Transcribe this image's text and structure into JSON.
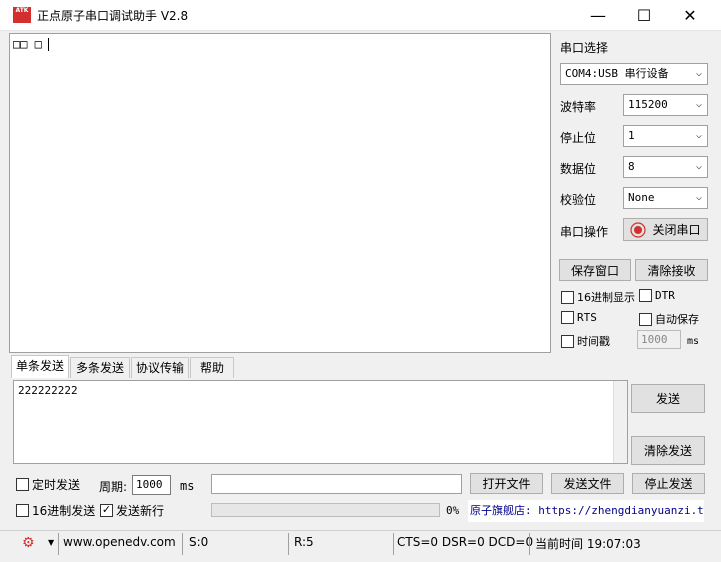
{
  "window": {
    "title": "正点原子串口调试助手 V2.8",
    "icon_text": "ATK",
    "controls": {
      "minimize": "—",
      "maximize": "☐",
      "close": "✕"
    }
  },
  "receive": {
    "content": "□□ □"
  },
  "port_panel": {
    "section_label": "串口选择",
    "port_value": "COM4:USB 串行设备",
    "baud_label": "波特率",
    "baud_value": "115200",
    "stop_label": "停止位",
    "stop_value": "1",
    "data_label": "数据位",
    "data_value": "8",
    "parity_label": "校验位",
    "parity_value": "None",
    "op_label": "串口操作",
    "op_button": "关闭串口",
    "save_window": "保存窗口",
    "clear_receive": "清除接收",
    "hex_display": "16进制显示",
    "dtr": "DTR",
    "rts": "RTS",
    "auto_save": "自动保存",
    "timestamp": "时间戳",
    "timestamp_ms_value": "1000",
    "ms_unit": "ms"
  },
  "tabs": [
    "单条发送",
    "多条发送",
    "协议传输",
    "帮助"
  ],
  "send": {
    "content": "222222222",
    "send_button": "发送",
    "clear_send": "清除发送"
  },
  "bottom": {
    "timed_send": "定时发送",
    "period_label": "周期:",
    "period_value": "1000",
    "period_unit": "ms",
    "open_file": "打开文件",
    "send_file": "发送文件",
    "stop_send": "停止发送",
    "hex_send": "16进制发送",
    "send_newline": "发送新行",
    "progress_text": "0%",
    "progress": 0,
    "store_link": "原子旗舰店: https://zhengdianyuanzi.tm"
  },
  "statusbar": {
    "website": "www.openedv.com",
    "sent": "S:0",
    "received": "R:5",
    "signals": "CTS=0 DSR=0 DCD=0",
    "time": "当前时间 19:07:03"
  },
  "colors": {
    "accent_red": "#d32f2f"
  }
}
